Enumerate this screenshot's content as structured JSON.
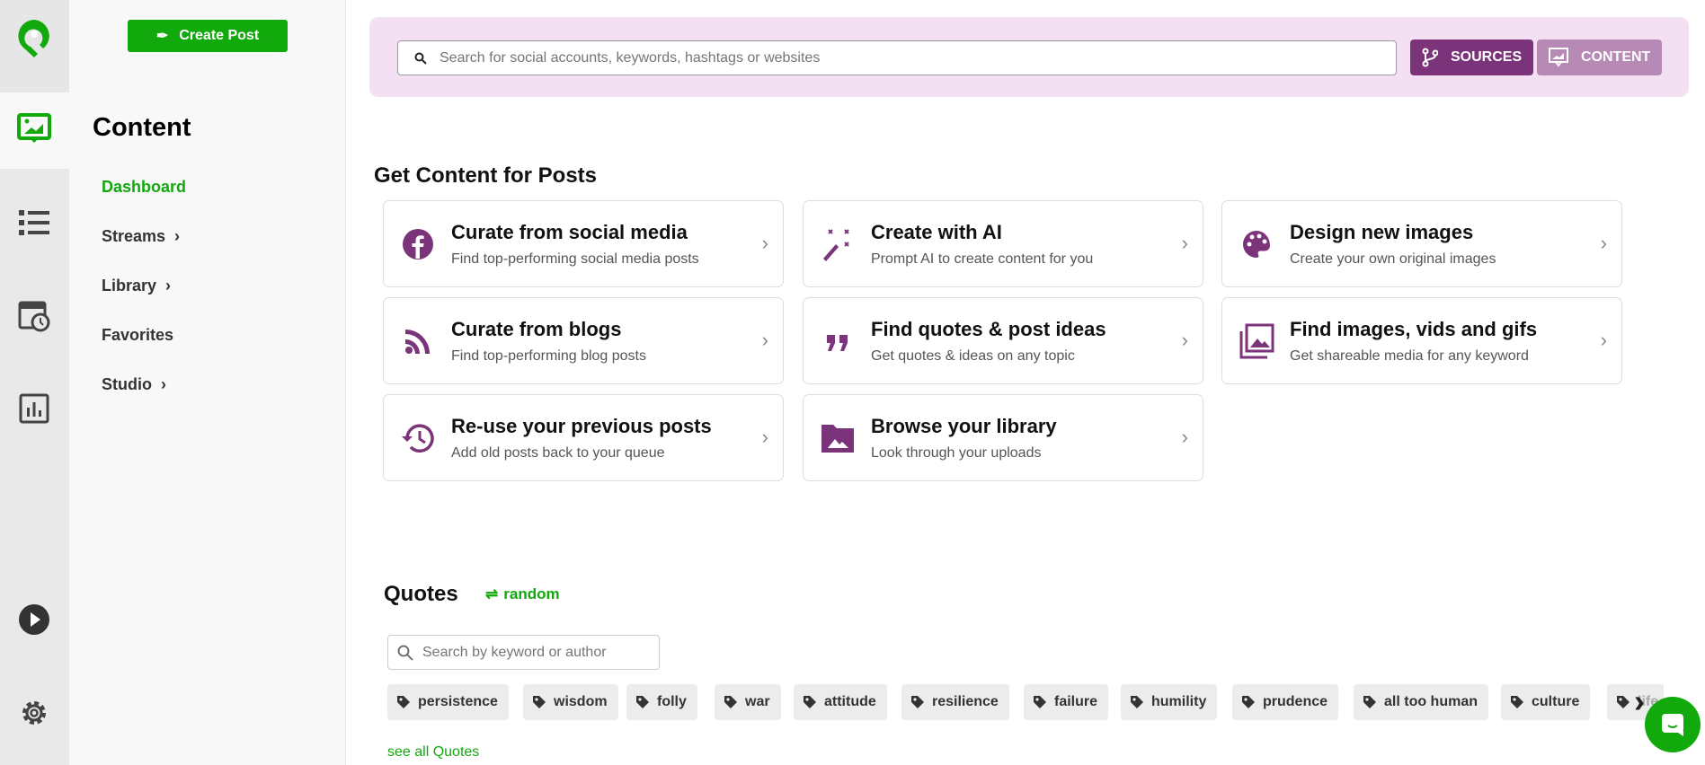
{
  "create_post_label": "Create Post",
  "sidebar": {
    "title": "Content",
    "items": [
      {
        "label": "Dashboard",
        "chevron": false,
        "active": true
      },
      {
        "label": "Streams",
        "chevron": true
      },
      {
        "label": "Library",
        "chevron": true
      },
      {
        "label": "Favorites",
        "chevron": false
      },
      {
        "label": "Studio",
        "chevron": true
      }
    ]
  },
  "search": {
    "placeholder": "Search for social accounts, keywords, hashtags or websites",
    "sources_label": "SOURCES",
    "content_label": "CONTENT"
  },
  "get_content": {
    "title": "Get Content for Posts",
    "cards": [
      {
        "title": "Curate from social media",
        "subtitle": "Find top-performing social media posts",
        "icon": "facebook-icon"
      },
      {
        "title": "Create with AI",
        "subtitle": "Prompt AI to create content for you",
        "icon": "magic-wand-icon"
      },
      {
        "title": "Design new images",
        "subtitle": "Create your own original images",
        "icon": "palette-icon"
      },
      {
        "title": "Curate from blogs",
        "subtitle": "Find top-performing blog posts",
        "icon": "rss-icon"
      },
      {
        "title": "Find quotes & post ideas",
        "subtitle": "Get quotes & ideas on any topic",
        "icon": "quote-icon"
      },
      {
        "title": "Find images, vids and gifs",
        "subtitle": "Get shareable media for any keyword",
        "icon": "images-icon"
      },
      {
        "title": "Re-use your previous posts",
        "subtitle": "Add old posts back to your queue",
        "icon": "history-icon"
      },
      {
        "title": "Browse your library",
        "subtitle": "Look through your uploads",
        "icon": "folder-image-icon"
      }
    ]
  },
  "quotes": {
    "title": "Quotes",
    "random_label": "random",
    "search_placeholder": "Search by keyword or author",
    "tags": [
      "persistence",
      "wisdom",
      "folly",
      "war",
      "attitude",
      "resilience",
      "failure",
      "humility",
      "prudence",
      "all too human",
      "culture",
      "life"
    ],
    "see_all": "see all Quotes"
  },
  "colors": {
    "brand_green": "#12a90d",
    "purple": "#7b3379",
    "purple_light": "#b78ab5",
    "banner": "#f3e1f3"
  }
}
